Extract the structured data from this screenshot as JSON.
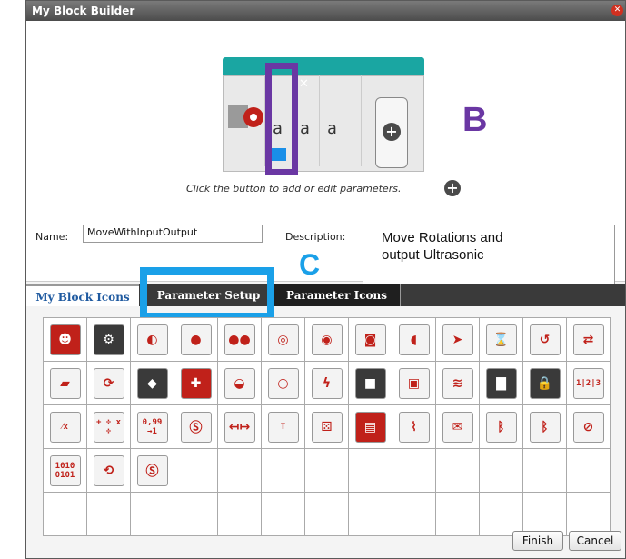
{
  "window": {
    "title": "My Block Builder"
  },
  "preview": {
    "params": [
      "a",
      "a",
      "a"
    ],
    "annotation_b": "B",
    "hint": "Click the button to add or edit parameters."
  },
  "form": {
    "name_label": "Name:",
    "name_value": "MoveWithInputOutput",
    "description_label": "Description:",
    "description_line1": "Move Rotations and",
    "description_line2": "output Ultrasonic"
  },
  "annotation_c": "C",
  "tabs": [
    {
      "label": "My Block Icons",
      "state": "active"
    },
    {
      "label": "Parameter Setup",
      "state": "highlighted"
    },
    {
      "label": "Parameter Icons",
      "state": "inactive"
    }
  ],
  "icons": [
    "brain-red",
    "brain-gears",
    "large-motor",
    "medium-motor",
    "tank-motors",
    "steering",
    "motor-sensor",
    "light-sensor",
    "sound-speaker",
    "motor-arrow",
    "timer-hourglass",
    "loop-stop",
    "motor-switch",
    "brick-gray",
    "brick-rotate",
    "dark-sensor",
    "medium-motor-cross",
    "color-sensor",
    "stopwatch",
    "motor-lightning",
    "dark-motor",
    "touch-sensor",
    "infrared-beam",
    "briefcase",
    "lock-briefcase",
    "numbers",
    "fraction",
    "arithmetic",
    "round",
    "random-swirl",
    "range",
    "text",
    "dice",
    "folder",
    "oscilloscope",
    "mail",
    "bluetooth",
    "bluetooth-off",
    "no-bluetooth",
    "binary",
    "motor-rotate",
    "swirl-sensor"
  ],
  "icon_texts": {
    "numbers": "1|2|3",
    "binary": "1010 0101",
    "round": "0,99 →1",
    "text": "T",
    "arithmetic": "+ ÷ x ÷",
    "fraction": "⁄x"
  },
  "buttons": {
    "finish": "Finish",
    "cancel": "Cancel"
  },
  "colors": {
    "teal": "#1aa6a2",
    "purple": "#6a37a3",
    "cyan": "#1aa0e8",
    "red": "#c0211a"
  }
}
